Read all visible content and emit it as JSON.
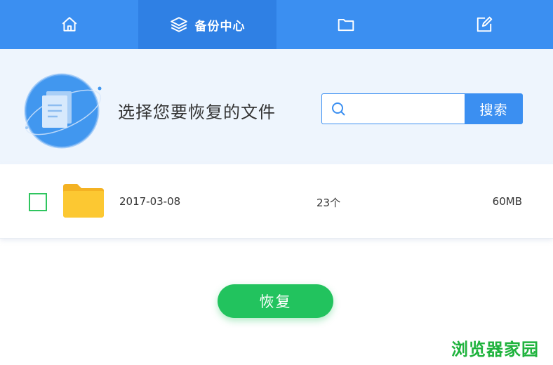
{
  "tabs": [
    {
      "icon": "home-icon",
      "label": ""
    },
    {
      "icon": "layers-icon",
      "label": "备份中心"
    },
    {
      "icon": "folder-icon",
      "label": ""
    },
    {
      "icon": "edit-icon",
      "label": ""
    }
  ],
  "header": {
    "heading": "选择您要恢复的文件",
    "search_placeholder": "",
    "search_button": "搜索"
  },
  "files": [
    {
      "date": "2017-03-08",
      "count": "23个",
      "size": "60MB",
      "checked": false
    }
  ],
  "actions": {
    "restore": "恢复"
  },
  "watermark": "浏览器家园",
  "colors": {
    "primary": "#3b8ff1",
    "active_tab": "#2f80e4",
    "success": "#22c35e",
    "folder": "#fbc02d",
    "header_bg": "#eef5fd"
  }
}
